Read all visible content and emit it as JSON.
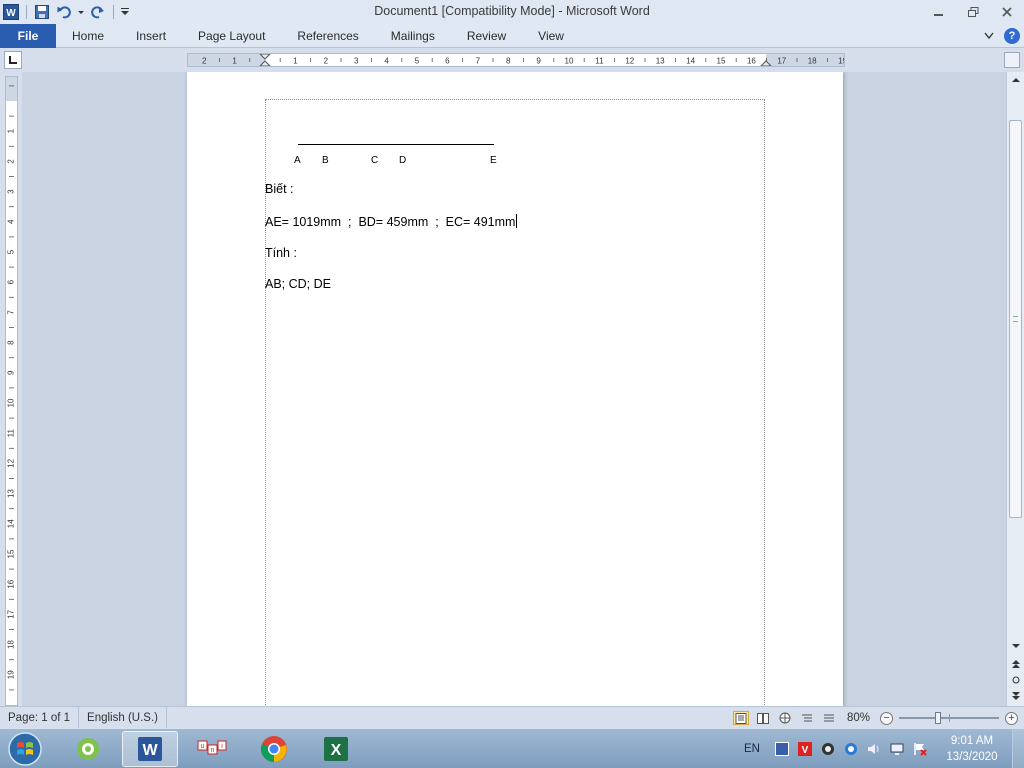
{
  "window": {
    "title": "Document1 [Compatibility Mode]  -  Microsoft Word"
  },
  "quick_access": {
    "icons": [
      "word-app-icon",
      "save-icon",
      "undo-icon",
      "dropdown-icon",
      "redo-icon",
      "customize-icon"
    ]
  },
  "ribbon": {
    "file_label": "File",
    "tabs": [
      {
        "label": "Home"
      },
      {
        "label": "Insert"
      },
      {
        "label": "Page Layout"
      },
      {
        "label": "References"
      },
      {
        "label": "Mailings"
      },
      {
        "label": "Review"
      },
      {
        "label": "View"
      }
    ],
    "help_label": "?"
  },
  "ruler": {
    "h_numbers": [
      "2",
      "1",
      "1",
      "2",
      "3",
      "4",
      "5",
      "6",
      "7",
      "8",
      "9",
      "10",
      "11",
      "12",
      "13",
      "14",
      "15",
      "16",
      "17",
      "18",
      "19"
    ],
    "v_numbers": [
      "1",
      "1",
      "2",
      "3",
      "4",
      "5",
      "6",
      "7",
      "8",
      "9",
      "10",
      "11",
      "12",
      "13",
      "14",
      "15",
      "16",
      "17",
      "18",
      "19"
    ]
  },
  "document": {
    "points": [
      "A",
      "B",
      "C",
      "D",
      "E"
    ],
    "lines": [
      "Biết :",
      "AE= 1019mm  ;  BD= 459mm  ;  EC= 491mm",
      "Tính :",
      "AB; CD; DE"
    ]
  },
  "statusbar": {
    "page": "Page: 1 of 1",
    "language": "English (U.S.)",
    "zoom": "80%",
    "zoom_level_percent": 80
  },
  "taskbar": {
    "apps": [
      "coccoc-icon",
      "word-icon",
      "unikey-icon",
      "chrome-icon",
      "excel-icon"
    ],
    "lang": "EN",
    "time": "9:01 AM",
    "date": "13/3/2020"
  },
  "colors": {
    "file_tab": "#2a5db0",
    "accent": "#2f6bd1",
    "page": "#ffffff"
  }
}
